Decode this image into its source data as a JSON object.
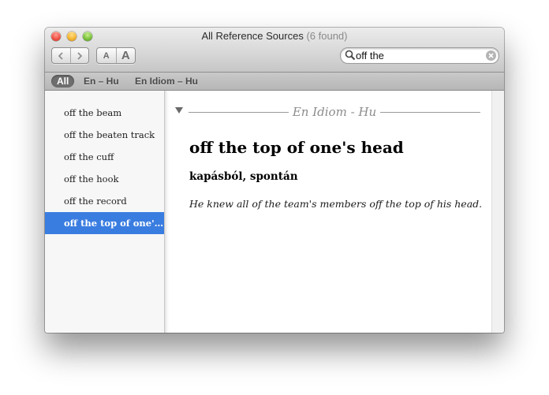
{
  "window": {
    "title": "All Reference Sources",
    "found_count": "(6 found)"
  },
  "toolbar": {
    "back_icon": "chevron-left",
    "forward_icon": "chevron-right",
    "font_smaller_label": "A",
    "font_larger_label": "A",
    "search_value": "off the",
    "search_icon": "magnifier",
    "clear_icon": "x-circle"
  },
  "scopebar": {
    "items": [
      {
        "label": "All",
        "selected": true
      },
      {
        "label": "En – Hu",
        "selected": false
      },
      {
        "label": "En Idiom – Hu",
        "selected": false
      }
    ]
  },
  "sidebar": {
    "items": [
      {
        "label": "off the beam",
        "selected": false
      },
      {
        "label": "off the beaten track",
        "selected": false
      },
      {
        "label": "off the cuff",
        "selected": false
      },
      {
        "label": "off the hook",
        "selected": false
      },
      {
        "label": "off the record",
        "selected": false
      },
      {
        "label": "off the top of one's head",
        "selected": true
      }
    ]
  },
  "entry": {
    "section_label": "En Idiom - Hu",
    "headword": "off the top of one's head",
    "translation": "kapásból, spontán",
    "example": "He knew all of the team's members off the top of his head."
  },
  "colors": {
    "selection": "#3a7de0",
    "scope_selected": "#6e6e6e",
    "section_label": "#8c8c8c"
  }
}
